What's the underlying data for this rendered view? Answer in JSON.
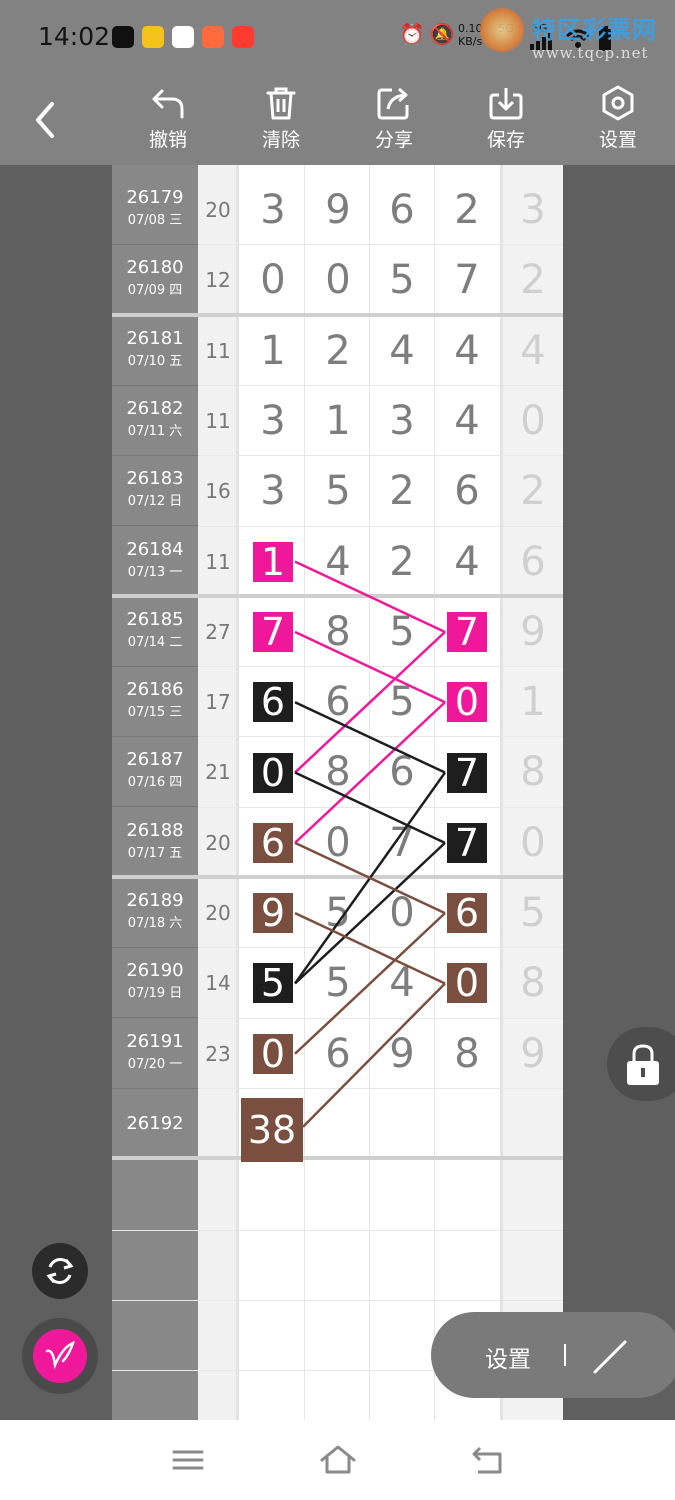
{
  "status_bar": {
    "time": "14:02",
    "net_speed": "0.10",
    "net_unit": "KB/s",
    "signal_1": "5G",
    "signal_2": "5G",
    "app_icons": [
      {
        "name": "tiktok-icon",
        "color": "#111111"
      },
      {
        "name": "sun-app-icon",
        "color": "#f5c21b"
      },
      {
        "name": "avatar-app-icon",
        "color": "#ffffff"
      },
      {
        "name": "video-app-icon",
        "color": "#ff6a3d"
      },
      {
        "name": "shop-app-icon",
        "color": "#ff3b30"
      }
    ]
  },
  "watermark": {
    "title": "特区彩票网",
    "url": "www.tqcp.net"
  },
  "toolbar": {
    "back_label": "",
    "buttons": [
      {
        "key": "undo",
        "label": "撤销",
        "icon": "undo-icon"
      },
      {
        "key": "clear",
        "label": "清除",
        "icon": "trash-icon"
      },
      {
        "key": "share",
        "label": "分享",
        "icon": "share-icon"
      },
      {
        "key": "save",
        "label": "保存",
        "icon": "download-icon"
      },
      {
        "key": "settings",
        "label": "设置",
        "icon": "hexagon-settings-icon"
      }
    ]
  },
  "rows": [
    {
      "id": "26179",
      "date": "07/08 三",
      "sum": "20",
      "d": [
        "3",
        "9",
        "6",
        "2"
      ],
      "last": "3"
    },
    {
      "id": "26180",
      "date": "07/09 四",
      "sum": "12",
      "d": [
        "0",
        "0",
        "5",
        "7"
      ],
      "last": "2"
    },
    {
      "id": "26181",
      "date": "07/10 五",
      "sum": "11",
      "d": [
        "1",
        "2",
        "4",
        "4"
      ],
      "last": "4"
    },
    {
      "id": "26182",
      "date": "07/11 六",
      "sum": "11",
      "d": [
        "3",
        "1",
        "3",
        "4"
      ],
      "last": "0"
    },
    {
      "id": "26183",
      "date": "07/12 日",
      "sum": "16",
      "d": [
        "3",
        "5",
        "2",
        "6"
      ],
      "last": "2"
    },
    {
      "id": "26184",
      "date": "07/13 一",
      "sum": "11",
      "d": [
        "1",
        "4",
        "2",
        "4"
      ],
      "last": "6"
    },
    {
      "id": "26185",
      "date": "07/14 二",
      "sum": "27",
      "d": [
        "7",
        "8",
        "5",
        "7"
      ],
      "last": "9"
    },
    {
      "id": "26186",
      "date": "07/15 三",
      "sum": "17",
      "d": [
        "6",
        "6",
        "5",
        "0"
      ],
      "last": "1"
    },
    {
      "id": "26187",
      "date": "07/16 四",
      "sum": "21",
      "d": [
        "0",
        "8",
        "6",
        "7"
      ],
      "last": "8"
    },
    {
      "id": "26188",
      "date": "07/17 五",
      "sum": "20",
      "d": [
        "6",
        "0",
        "7",
        "7"
      ],
      "last": "0"
    },
    {
      "id": "26189",
      "date": "07/18 六",
      "sum": "20",
      "d": [
        "9",
        "5",
        "0",
        "6"
      ],
      "last": "5"
    },
    {
      "id": "26190",
      "date": "07/19 日",
      "sum": "14",
      "d": [
        "5",
        "5",
        "4",
        "0"
      ],
      "last": "8"
    },
    {
      "id": "26191",
      "date": "07/20 一",
      "sum": "23",
      "d": [
        "0",
        "6",
        "9",
        "8"
      ],
      "last": "9"
    },
    {
      "id": "26192",
      "date": "",
      "sum": "",
      "d": [
        "",
        "",
        "",
        ""
      ],
      "last": ""
    }
  ],
  "highlights": [
    {
      "row": 5,
      "col": 0,
      "color": "#f0189a"
    },
    {
      "row": 6,
      "col": 0,
      "color": "#f0189a"
    },
    {
      "row": 6,
      "col": 3,
      "color": "#f0189a"
    },
    {
      "row": 7,
      "col": 3,
      "color": "#f0189a"
    },
    {
      "row": 7,
      "col": 0,
      "color": "#1e1e1e"
    },
    {
      "row": 8,
      "col": 0,
      "color": "#1e1e1e"
    },
    {
      "row": 8,
      "col": 3,
      "color": "#1e1e1e"
    },
    {
      "row": 9,
      "col": 3,
      "color": "#1e1e1e"
    },
    {
      "row": 9,
      "col": 0,
      "color": "#7b4f3f"
    },
    {
      "row": 10,
      "col": 0,
      "color": "#7b4f3f"
    },
    {
      "row": 10,
      "col": 3,
      "color": "#7b4f3f"
    },
    {
      "row": 11,
      "col": 3,
      "color": "#7b4f3f"
    },
    {
      "row": 11,
      "col": 0,
      "color": "#1e1e1e"
    },
    {
      "row": 12,
      "col": 0,
      "color": "#7b4f3f"
    }
  ],
  "prediction_value": "38",
  "colors": {
    "pink": "#f0189a",
    "black": "#1e1e1e",
    "brown": "#7b4f3f"
  },
  "connectors": [
    {
      "from": [
        5,
        0
      ],
      "to": [
        6,
        3
      ],
      "color": "pink"
    },
    {
      "from": [
        6,
        0
      ],
      "to": [
        7,
        3
      ],
      "color": "pink"
    },
    {
      "from": [
        6,
        3
      ],
      "to": [
        8,
        0
      ],
      "color": "pink"
    },
    {
      "from": [
        7,
        3
      ],
      "to": [
        9,
        0
      ],
      "color": "pink"
    },
    {
      "from": [
        7,
        0
      ],
      "to": [
        8,
        3
      ],
      "color": "black"
    },
    {
      "from": [
        8,
        0
      ],
      "to": [
        9,
        3
      ],
      "color": "black"
    },
    {
      "from": [
        8,
        3
      ],
      "to": [
        11,
        0
      ],
      "color": "black"
    },
    {
      "from": [
        9,
        3
      ],
      "to": [
        11,
        0
      ],
      "color": "black"
    },
    {
      "from": [
        9,
        0
      ],
      "to": [
        10,
        3
      ],
      "color": "brown"
    },
    {
      "from": [
        10,
        0
      ],
      "to": [
        11,
        3
      ],
      "color": "brown"
    },
    {
      "from": [
        10,
        3
      ],
      "to": [
        12,
        0
      ],
      "color": "brown"
    },
    {
      "from": [
        11,
        3
      ],
      "to": [
        13,
        0
      ],
      "color": "brown"
    }
  ],
  "floating": {
    "settings_label": "设置",
    "refresh_icon": "refresh-icon",
    "pen_icon": "pen-icon",
    "lock_icon": "lock-icon",
    "line_tool_icon": "line-tool-icon"
  },
  "navbar": {
    "menu_icon": "menu-icon",
    "home_icon": "home-icon",
    "back_icon": "back-arrow-icon"
  }
}
